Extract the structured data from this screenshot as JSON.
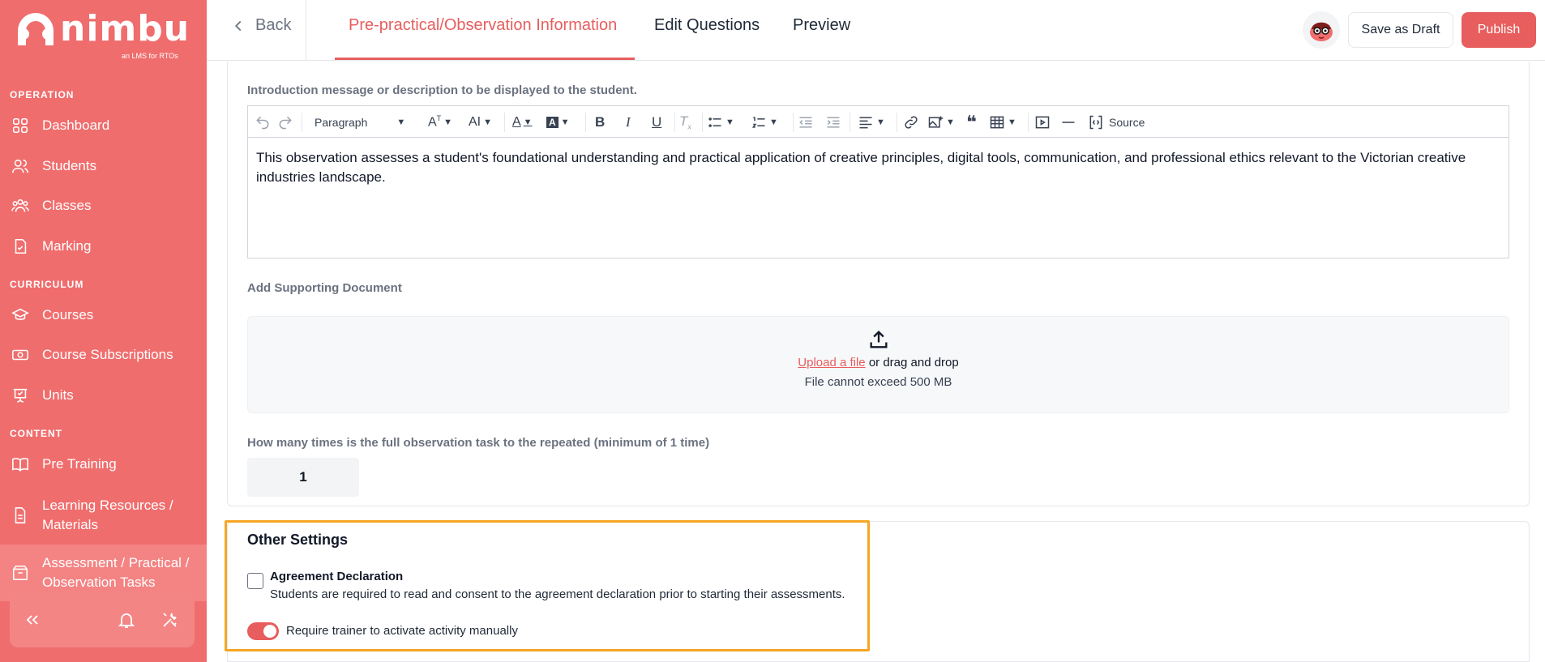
{
  "app": {
    "logo_text": "nimbu",
    "logo_sub": "an LMS for RTOs",
    "accent_color": "#e85d5d",
    "sidebar_color": "#f06d6d"
  },
  "sidebar": {
    "sections": [
      {
        "title": "OPERATION"
      },
      {
        "title": "CURRICULUM"
      },
      {
        "title": "CONTENT"
      }
    ],
    "items": [
      {
        "label": "Dashboard",
        "icon": "grid-icon"
      },
      {
        "label": "Students",
        "icon": "users-icon"
      },
      {
        "label": "Classes",
        "icon": "group-icon"
      },
      {
        "label": "Marking",
        "icon": "clipboard-check-icon"
      },
      {
        "label": "Courses",
        "icon": "graduation-cap-icon"
      },
      {
        "label": "Course Subscriptions",
        "icon": "cash-icon"
      },
      {
        "label": "Units",
        "icon": "presentation-icon"
      },
      {
        "label": "Pre Training",
        "icon": "book-open-icon"
      },
      {
        "label": "Learning Resources / Materials",
        "icon": "document-icon"
      },
      {
        "label": "Assessment / Practical / Observation Tasks",
        "icon": "archive-icon",
        "active": true
      }
    ],
    "footer": {
      "collapse_icon": "chevrons-left-icon",
      "notification_icon": "bell-icon",
      "settings_icon": "tools-icon"
    }
  },
  "topbar": {
    "back_label": "Back",
    "tabs": [
      {
        "label": "Pre-practical/Observation Information",
        "active": true
      },
      {
        "label": "Edit Questions"
      },
      {
        "label": "Preview"
      }
    ],
    "save_draft_label": "Save as Draft",
    "publish_label": "Publish"
  },
  "form": {
    "intro_label": "Introduction message or description to be displayed to the student.",
    "editor": {
      "paragraph_style": "Paragraph",
      "source_label": "Source",
      "content": "This observation assesses a student's foundational understanding and practical application of creative principles, digital tools, communication, and professional ethics relevant to the Victorian creative industries landscape."
    },
    "supporting_doc_label": "Add Supporting Document",
    "upload": {
      "link_label": "Upload a file",
      "rest_label": " or drag and drop",
      "note": "File cannot exceed 500 MB"
    },
    "repeat_label": "How many times is the full observation task to the repeated (minimum of 1 time)",
    "repeat_value": "1"
  },
  "other_settings": {
    "title": "Other Settings",
    "agreement_title": "Agreement Declaration",
    "agreement_desc": "Students are required to read and consent to the agreement declaration prior to starting their assessments.",
    "agreement_checked": false,
    "toggle_label": "Require trainer to activate activity manually",
    "toggle_on": true,
    "highlight_color": "#f5a623"
  }
}
